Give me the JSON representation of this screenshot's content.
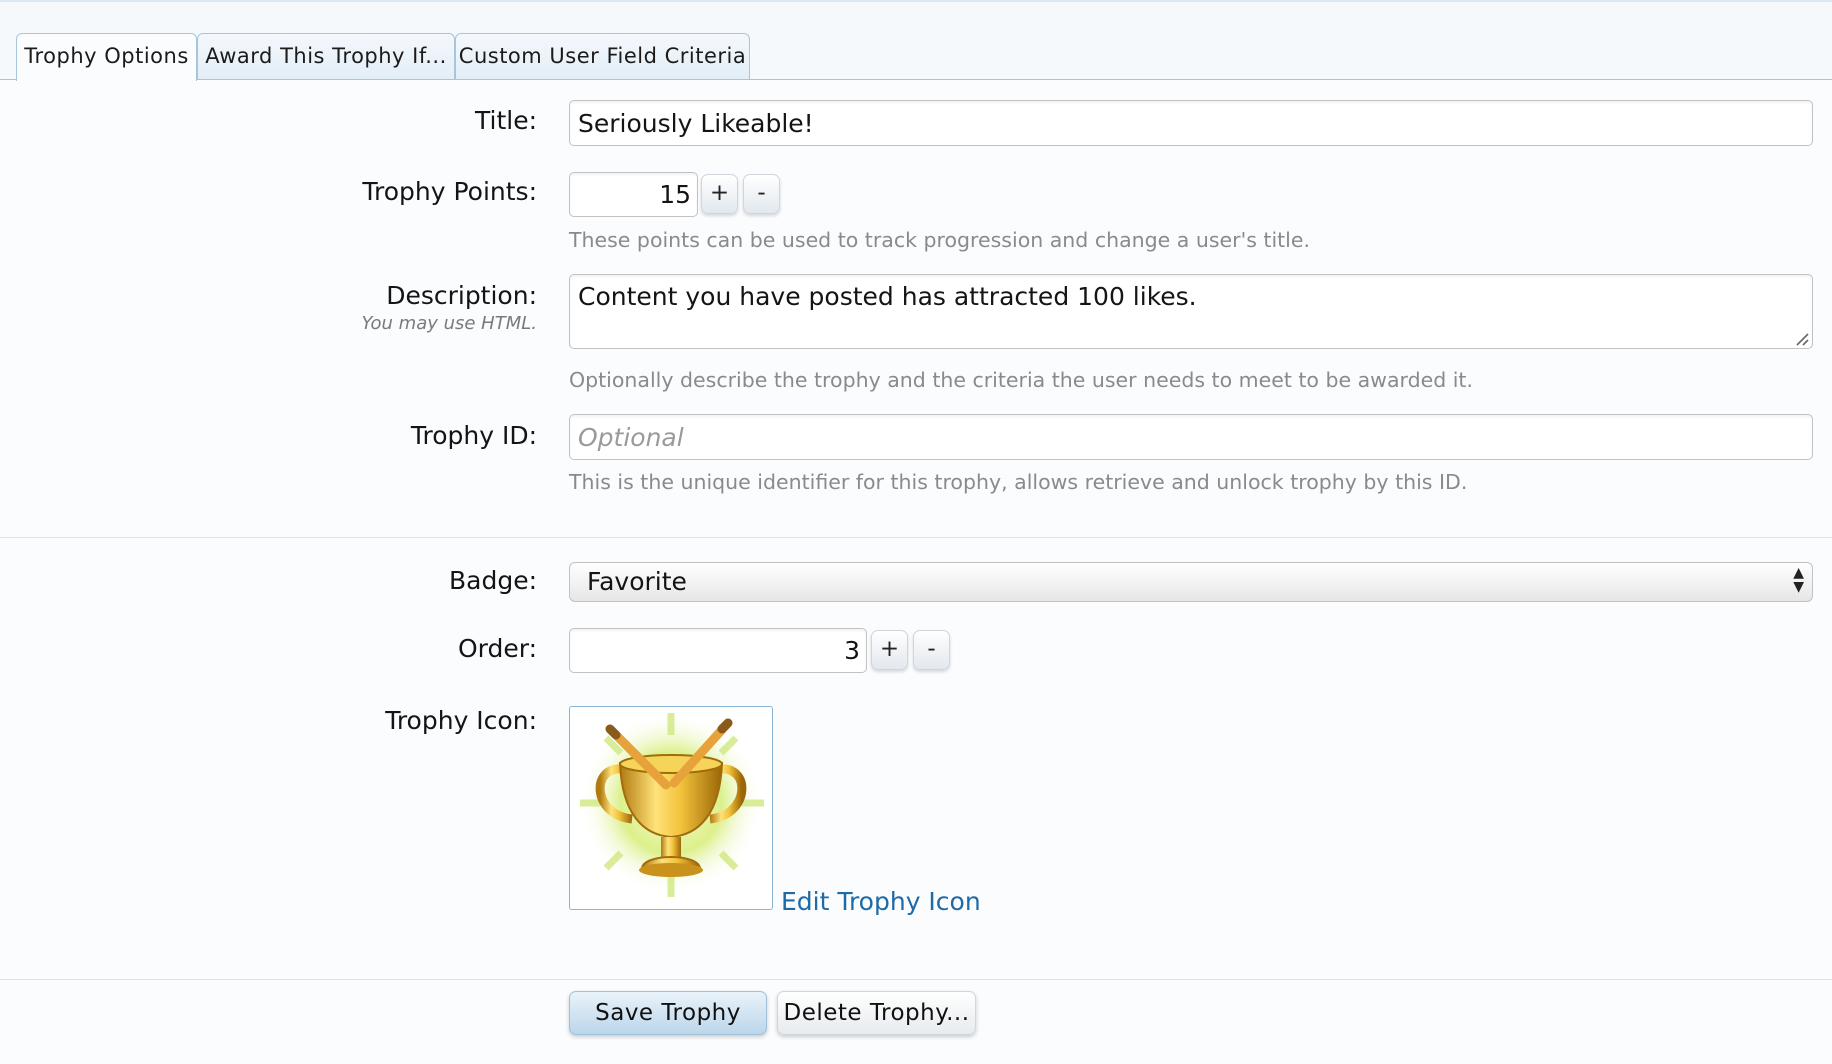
{
  "tabs": [
    {
      "label": "Trophy Options",
      "active": true
    },
    {
      "label": "Award This Trophy If..."
    },
    {
      "label": "Custom User Field Criteria"
    }
  ],
  "form": {
    "title": {
      "label": "Title:",
      "value": "Seriously Likeable!"
    },
    "trophy_points": {
      "label": "Trophy Points:",
      "value": "15",
      "plus": "+",
      "minus": "-",
      "hint": "These points can be used to track progression and change a user's title."
    },
    "description": {
      "label": "Description:",
      "sublabel": "You may use HTML.",
      "value": "Content you have posted has attracted 100 likes.",
      "hint": "Optionally describe the trophy and the criteria the user needs to meet to be awarded it."
    },
    "trophy_id": {
      "label": "Trophy ID:",
      "value": "",
      "placeholder": "Optional",
      "hint": "This is the unique identifier for this trophy, allows retrieve and unlock trophy by this ID."
    },
    "badge": {
      "label": "Badge:",
      "selected": "Favorite"
    },
    "order": {
      "label": "Order:",
      "value": "3",
      "plus": "+",
      "minus": "-"
    },
    "trophy_icon": {
      "label": "Trophy Icon:",
      "icon": "golden-trophy-icon",
      "edit_link": "Edit Trophy Icon"
    }
  },
  "buttons": {
    "save": "Save Trophy",
    "delete": "Delete Trophy..."
  },
  "colors": {
    "link": "#1f6aa5",
    "tab_border": "#a9c5dc",
    "primary_button": "#bcd6ea",
    "hint_text": "#8a8a8a"
  }
}
